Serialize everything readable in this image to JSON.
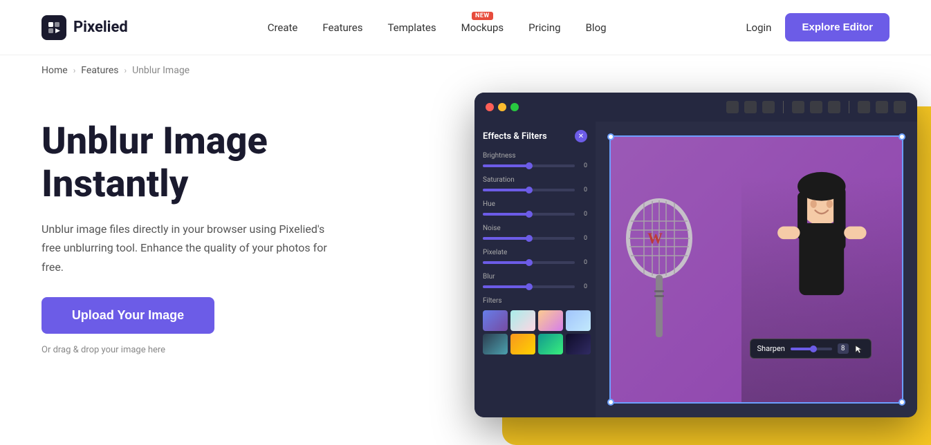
{
  "brand": {
    "name": "Pixelied",
    "logo_icon": "play-icon"
  },
  "nav": {
    "items": [
      {
        "label": "Create",
        "id": "create"
      },
      {
        "label": "Features",
        "id": "features"
      },
      {
        "label": "Templates",
        "id": "templates"
      },
      {
        "label": "Mockups",
        "id": "mockups",
        "badge": "NEW"
      },
      {
        "label": "Pricing",
        "id": "pricing"
      },
      {
        "label": "Blog",
        "id": "blog"
      }
    ],
    "login_label": "Login",
    "explore_label": "Explore Editor"
  },
  "breadcrumb": {
    "home": "Home",
    "features": "Features",
    "current": "Unblur Image"
  },
  "hero": {
    "title_line1": "Unblur Image",
    "title_line2": "Instantly",
    "description": "Unblur image files directly in your browser using Pixelied's free unblurring tool. Enhance the quality of your photos for free.",
    "upload_btn": "Upload Your Image",
    "drag_drop": "Or drag & drop your image here"
  },
  "app_ui": {
    "panel_title": "Effects & Filters",
    "sliders": [
      {
        "label": "Brightness",
        "value": "0",
        "fill_pct": 50
      },
      {
        "label": "Saturation",
        "value": "0",
        "fill_pct": 50
      },
      {
        "label": "Hue",
        "value": "0",
        "fill_pct": 50
      },
      {
        "label": "Noise",
        "value": "0",
        "fill_pct": 50
      },
      {
        "label": "Pixelate",
        "value": "0",
        "fill_pct": 50
      },
      {
        "label": "Blur",
        "value": "0",
        "fill_pct": 50
      }
    ],
    "filters_label": "Filters",
    "sharpen_label": "Sharpen",
    "sharpen_value": "8"
  }
}
